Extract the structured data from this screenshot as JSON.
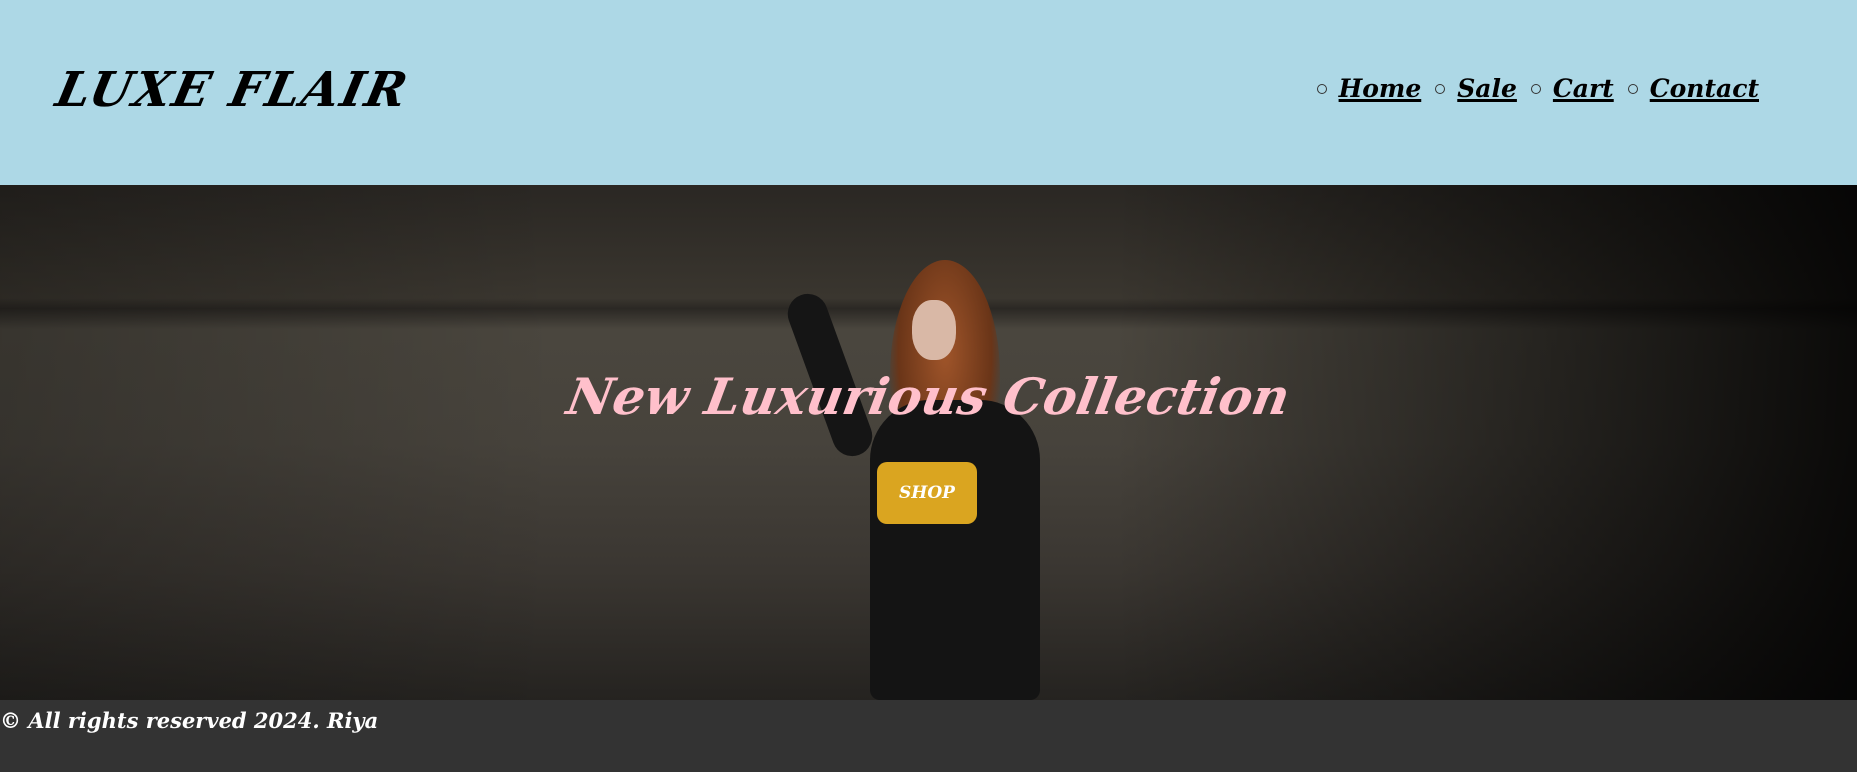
{
  "header": {
    "logo": "LUXE FLAIR",
    "nav": [
      {
        "label": "Home"
      },
      {
        "label": "Sale"
      },
      {
        "label": "Cart"
      },
      {
        "label": "Contact"
      }
    ]
  },
  "hero": {
    "title": "New Luxurious Collection",
    "button_label": "SHOP"
  },
  "footer": {
    "text": "© All rights reserved 2024. Riya"
  },
  "colors": {
    "header_bg": "#add8e6",
    "title": "#ffc0cb",
    "button": "#daa520",
    "footer_bg": "#333333"
  }
}
